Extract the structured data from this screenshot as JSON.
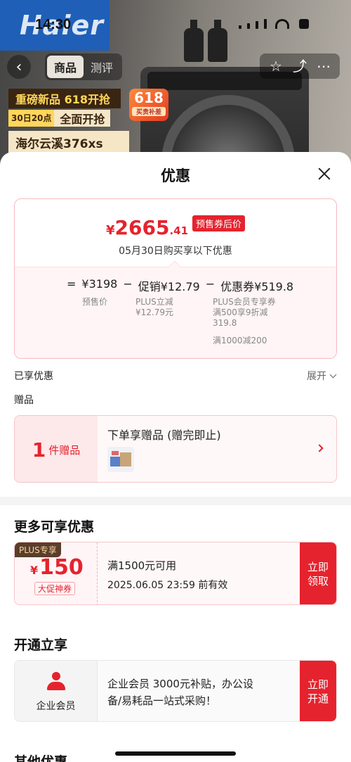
{
  "status_bar": {
    "time": "14:30"
  },
  "background": {
    "brand": "Haier",
    "nav_tabs": [
      {
        "label": "商品"
      },
      {
        "label": "测评"
      }
    ],
    "promo": {
      "line1": "重磅新品 618开抢",
      "date": "30日20点",
      "open": "全面开抢",
      "product": "海尔云溪376xs"
    },
    "badge": {
      "number": "618",
      "sub": "买贵补差"
    }
  },
  "sheet": {
    "title": "优惠",
    "price": {
      "symbol": "¥",
      "integer": "2665",
      "decimal": ".41",
      "tag": "预售券后价",
      "subtitle": "05月30日购买享以下优惠"
    },
    "breakdown": {
      "eq": "=",
      "base": "¥3198",
      "minus1": "−",
      "promo": "促销¥12.79",
      "minus2": "−",
      "coupon": "优惠券¥519.8",
      "base_label": "预售价",
      "promo_detail_1": "PLUS立减",
      "promo_detail_2": "¥12.79元",
      "coupon_detail_1": "PLUS会员专享券",
      "coupon_detail_2": "满500享9折减",
      "coupon_detail_3": "319.8",
      "coupon_detail_4": "满1000减200"
    },
    "enjoyed_label": "已享优惠",
    "expand_label": "展开",
    "gift_label": "赠品",
    "gift": {
      "count": "1",
      "unit": "件赠品",
      "title": "下单享赠品 (赠完即止)"
    },
    "more_title": "更多可享优惠",
    "coupon": {
      "badge": "PLUS专享",
      "symbol": "¥",
      "amount": "150",
      "type": "大促神券",
      "condition": "满1500元可用",
      "expiry": "2025.06.05 23:59 前有效",
      "button": "立即领取"
    },
    "open_title": "开通立享",
    "member": {
      "label": "企业会员",
      "text_line1": "企业会员 3000元补贴，办公设",
      "text_line2": "备/易耗品一站式采购！",
      "button": "立即开通"
    },
    "other_title": "其他优惠"
  }
}
